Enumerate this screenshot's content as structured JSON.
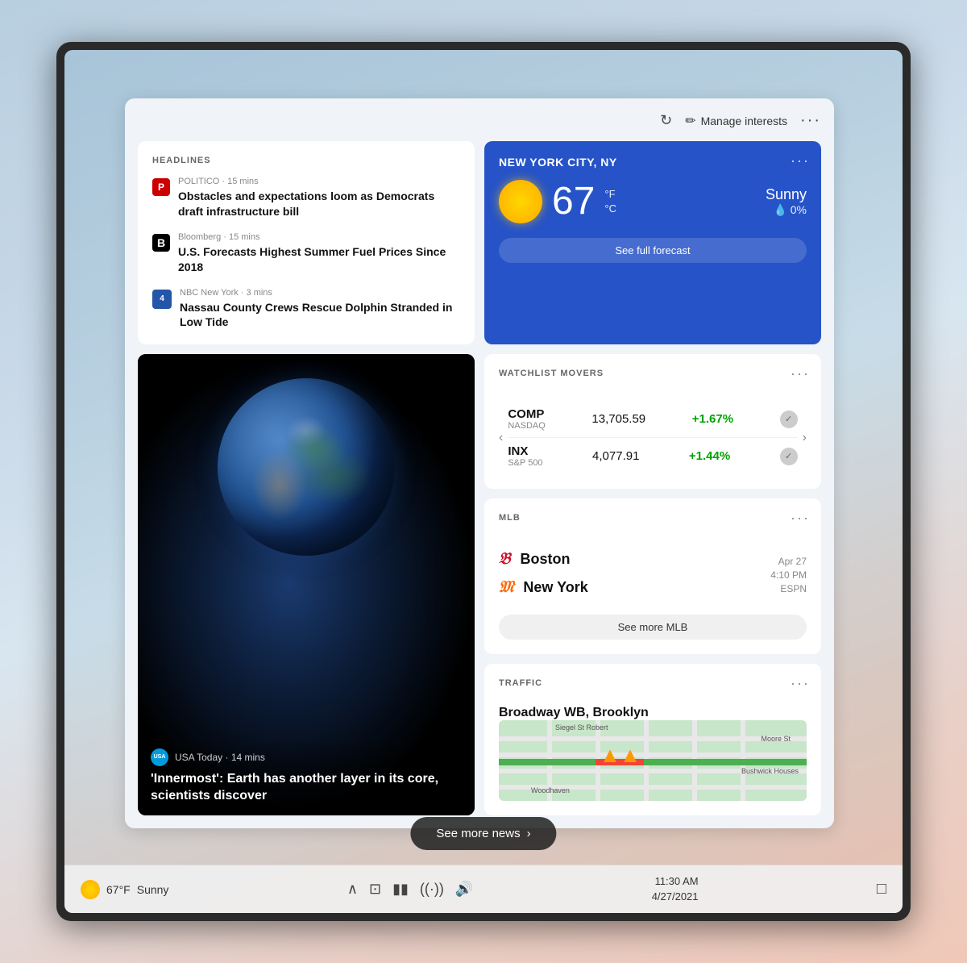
{
  "panel": {
    "manage_interests": "Manage interests",
    "refresh_icon": "↻",
    "pencil_icon": "✏",
    "more_icon": "···"
  },
  "headlines": {
    "label": "HEADLINES",
    "items": [
      {
        "source": "POLITICO",
        "source_logo": "P",
        "logo_class": "logo-politico",
        "time": "15 mins",
        "headline": "Obstacles and expectations loom as Democrats draft infrastructure bill"
      },
      {
        "source": "Bloomberg",
        "source_logo": "B",
        "logo_class": "logo-bloomberg",
        "time": "15 mins",
        "headline": "U.S. Forecasts Highest Summer Fuel Prices Since 2018"
      },
      {
        "source": "NBC New York",
        "source_logo": "4",
        "logo_class": "logo-nbc",
        "time": "3 mins",
        "headline": "Nassau County Crews Rescue Dolphin Stranded in Low Tide"
      }
    ]
  },
  "weather": {
    "location": "NEW YORK CITY, NY",
    "temperature": "67",
    "unit_f": "°F",
    "unit_c": "°C",
    "condition": "Sunny",
    "precip": "0%",
    "precip_icon": "💧",
    "see_forecast": "See full forecast",
    "more_icon": "···"
  },
  "watchlist": {
    "label": "WATCHLIST MOVERS",
    "more_icon": "···",
    "stocks": [
      {
        "ticker": "COMP",
        "exchange": "NASDAQ",
        "price": "13,705.59",
        "change": "+1.67%"
      },
      {
        "ticker": "INX",
        "exchange": "S&P 500",
        "price": "4,077.91",
        "change": "+1.44%"
      }
    ]
  },
  "earth_news": {
    "source": "USA Today",
    "time": "14 mins",
    "headline": "'Innermost': Earth has another layer in its core, scientists discover"
  },
  "mlb": {
    "label": "MLB",
    "more_icon": "···",
    "team1": "Boston",
    "team2": "New York",
    "date": "Apr 27",
    "time": "4:10 PM",
    "channel": "ESPN",
    "see_more": "See more MLB"
  },
  "traffic": {
    "label": "TRAFFIC",
    "location": "Broadway WB, Brooklyn",
    "more_icon": "···"
  },
  "see_more_news": {
    "label": "See more news",
    "arrow": "›"
  },
  "taskbar": {
    "temperature": "67°F",
    "condition": "Sunny",
    "time": "11:30 AM",
    "date": "4/27/2021"
  }
}
